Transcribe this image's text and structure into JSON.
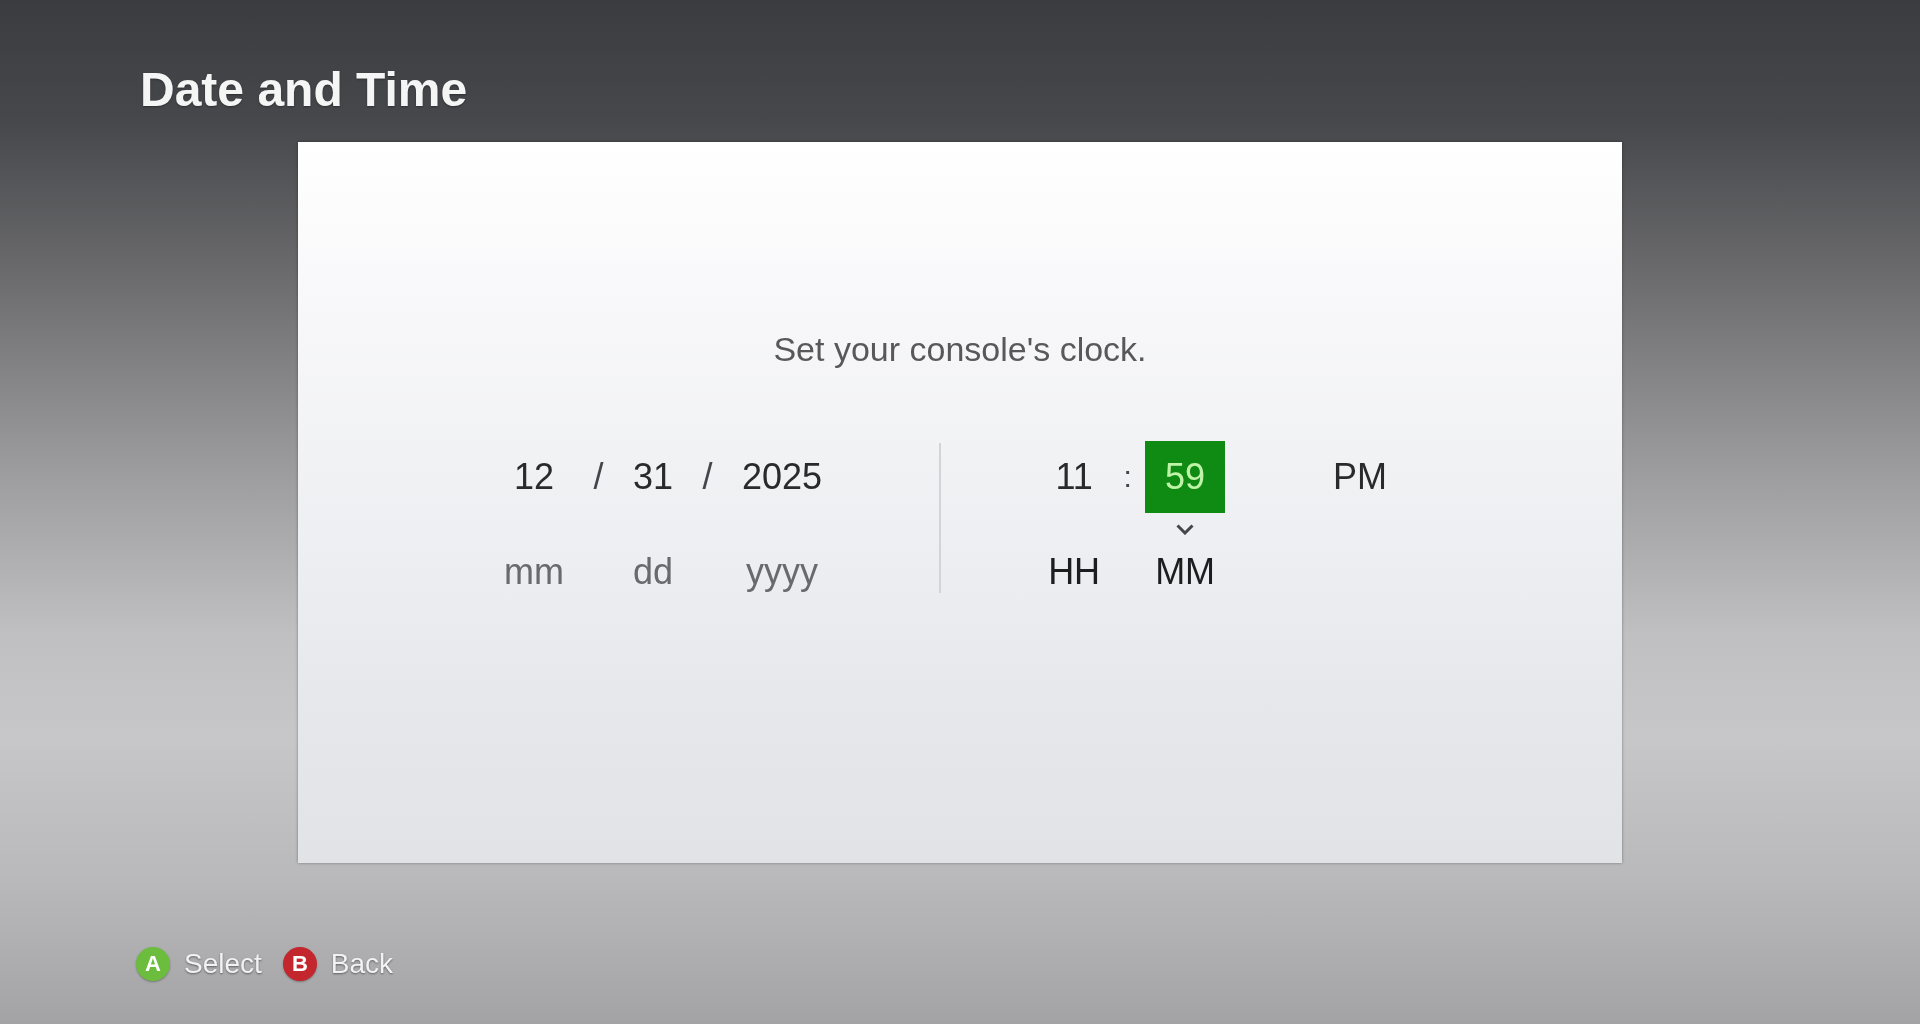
{
  "screen": {
    "title": "Date and Time"
  },
  "dialog": {
    "prompt": "Set your console's clock.",
    "date": {
      "items": [
        {
          "kind": "field",
          "value": "12",
          "label": "mm",
          "selected": false
        },
        {
          "kind": "separator",
          "text": "/"
        },
        {
          "kind": "field",
          "value": "31",
          "label": "dd",
          "selected": false
        },
        {
          "kind": "separator",
          "text": "/"
        },
        {
          "kind": "field",
          "value": "2025",
          "label": "yyyy",
          "selected": false
        }
      ]
    },
    "time": {
      "items": [
        {
          "kind": "field",
          "value": "11",
          "label": "HH",
          "selected": false
        },
        {
          "kind": "separator",
          "text": ":"
        },
        {
          "kind": "field",
          "value": "59",
          "label": "MM",
          "selected": true
        },
        {
          "kind": "period",
          "value": "PM",
          "selected": false
        }
      ]
    }
  },
  "button_hints": [
    {
      "key": "A",
      "label": "Select",
      "color": "#6cbd3e"
    },
    {
      "key": "B",
      "label": "Back",
      "color": "#c4262d"
    }
  ]
}
